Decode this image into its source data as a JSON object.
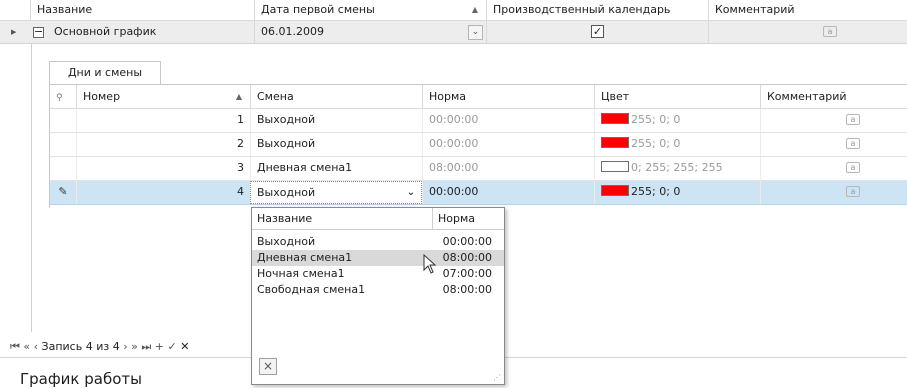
{
  "outer_grid": {
    "columns": [
      {
        "label": "Название"
      },
      {
        "label": "Дата первой смены"
      },
      {
        "label": "Производственный календарь"
      },
      {
        "label": "Комментарий"
      }
    ],
    "row": {
      "name": "Основной график",
      "first_shift_date": "06.01.2009",
      "calendar_checked": true
    }
  },
  "detail": {
    "tab_label": "Дни и смены",
    "columns": [
      {
        "label": "Номер"
      },
      {
        "label": "Смена"
      },
      {
        "label": "Норма"
      },
      {
        "label": "Цвет"
      },
      {
        "label": "Комментарий"
      }
    ],
    "rows": [
      {
        "number": "1",
        "shift": "Выходной",
        "norm": "00:00:00",
        "color_text": "255; 0; 0",
        "color": "#ff0000"
      },
      {
        "number": "2",
        "shift": "Выходной",
        "norm": "00:00:00",
        "color_text": "255; 0; 0",
        "color": "#ff0000"
      },
      {
        "number": "3",
        "shift": "Дневная смена1",
        "norm": "08:00:00",
        "color_text": "0; 255; 255; 255",
        "color": "#ffffff"
      },
      {
        "number": "4",
        "shift": "Выходной",
        "norm": "00:00:00",
        "color_text": "255; 0; 0",
        "color": "#ff0000"
      }
    ]
  },
  "dropdown": {
    "col_name": "Название",
    "col_norm": "Норма",
    "items": [
      {
        "name": "Выходной",
        "norm": "00:00:00"
      },
      {
        "name": "Дневная смена1",
        "norm": "08:00:00",
        "highlighted": true
      },
      {
        "name": "Ночная смена1",
        "norm": "07:00:00"
      },
      {
        "name": "Свободная смена1",
        "norm": "08:00:00"
      }
    ],
    "close_glyph": "×"
  },
  "navigator": {
    "record_text": "Запись 4 из 4"
  },
  "bottom": {
    "title": "График работы"
  },
  "colors": {
    "selected_row": "#cde4f5",
    "highlight_item": "#d9d9d9",
    "swatch_red": "#ff0000"
  }
}
